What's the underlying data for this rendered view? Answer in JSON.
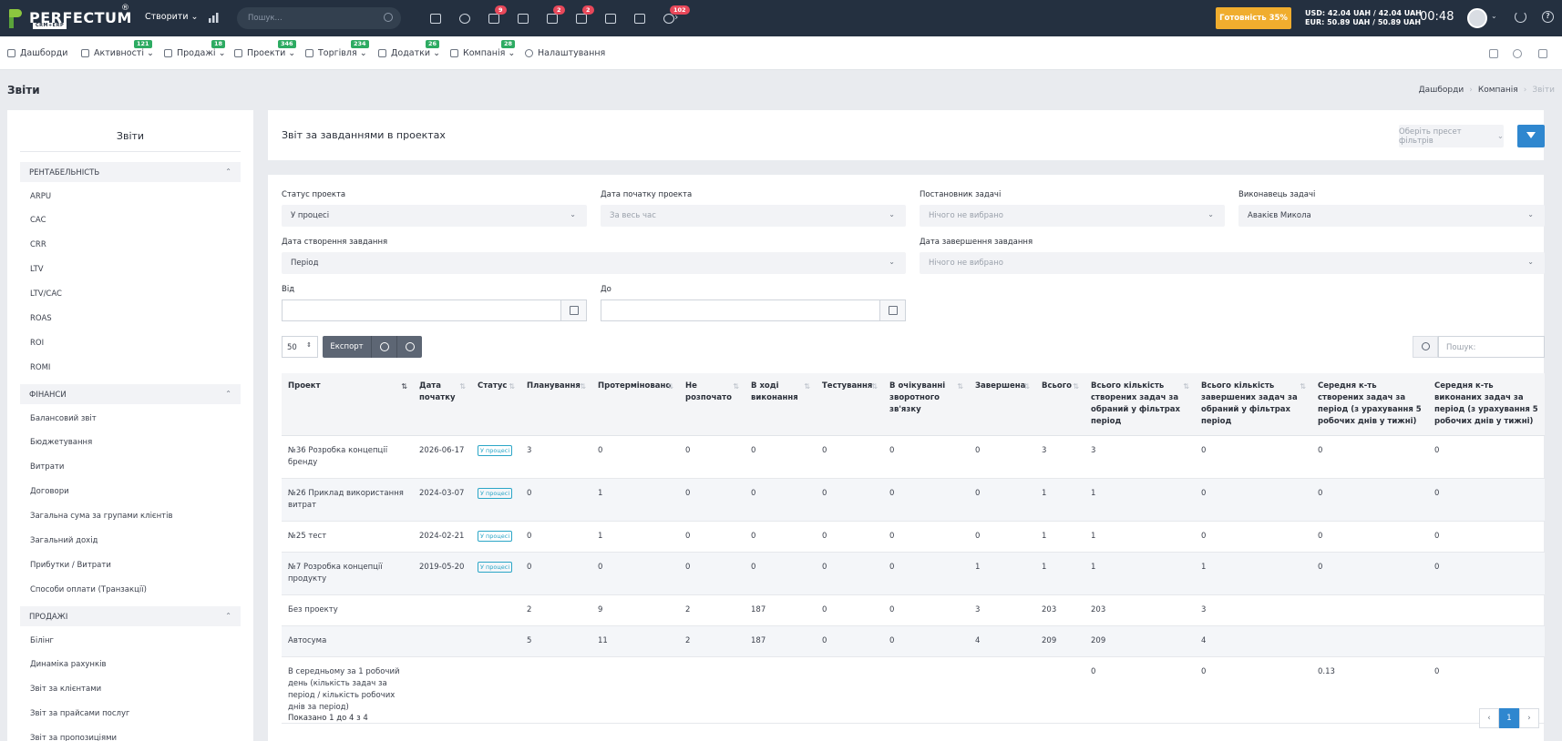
{
  "topbar": {
    "logo": "PERFECTUM",
    "logo_sub": "CRM+ERP",
    "create_label": "Створити",
    "search_placeholder": "Пошук...",
    "icons": [
      {
        "name": "calendar-icon",
        "badge": ""
      },
      {
        "name": "chat-icon",
        "badge": ""
      },
      {
        "name": "tasks-icon",
        "badge": "9"
      },
      {
        "name": "clipboard-icon",
        "badge": ""
      },
      {
        "name": "comments-icon",
        "badge": "2"
      },
      {
        "name": "messages-icon",
        "badge": "2"
      },
      {
        "name": "file-icon",
        "badge": ""
      },
      {
        "name": "mail-icon",
        "badge": ""
      },
      {
        "name": "bell-icon",
        "badge": "102"
      }
    ],
    "readiness_label": "Готовність 35%",
    "usd_rate": "USD: 42.04 UAH / 42.04 UAH",
    "eur_rate": "EUR: 50.89 UAH / 50.89 UAH",
    "clock": "00:48"
  },
  "nav": {
    "items": [
      {
        "label": "Дашборди",
        "badge": ""
      },
      {
        "label": "Активності",
        "badge": "121"
      },
      {
        "label": "Продажі",
        "badge": "18"
      },
      {
        "label": "Проекти",
        "badge": "346"
      },
      {
        "label": "Торгівля",
        "badge": "234"
      },
      {
        "label": "Додатки",
        "badge": "26"
      },
      {
        "label": "Компанія",
        "badge": "28"
      },
      {
        "label": "Налаштування",
        "badge": ""
      }
    ]
  },
  "page": {
    "title": "Звіти",
    "breadcrumb": [
      "Дашборди",
      "Компанія",
      "Звіти"
    ]
  },
  "sidebar": {
    "title": "Звіти",
    "sections": [
      {
        "title": "РЕНТАБЕЛЬНІСТЬ",
        "items": [
          "ARPU",
          "CAC",
          "CRR",
          "LTV",
          "LTV/CAC",
          "ROAS",
          "ROI",
          "ROMI"
        ]
      },
      {
        "title": "ФІНАНСИ",
        "items": [
          "Балансовий звіт",
          "Бюджетування",
          "Витрати",
          "Договори",
          "Загальна сума за групами клієнтів",
          "Загальний дохід",
          "Прибутки / Витрати",
          "Способи оплати (Транзакції)"
        ]
      },
      {
        "title": "ПРОДАЖІ",
        "items": [
          "Білінг",
          "Динаміка рахунків",
          "Звіт за клієнтами",
          "Звіт за прайсами послуг",
          "Звіт за пропозиціями"
        ]
      }
    ]
  },
  "report": {
    "title": "Звіт за завданнями в проектах",
    "preset_placeholder": "Оберіть пресет фільтрів"
  },
  "filters": {
    "project_status": {
      "label": "Статус проекта",
      "value": "У процесі"
    },
    "project_start": {
      "label": "Дата початку проекта",
      "value": "За весь час"
    },
    "task_author": {
      "label": "Постановник задачі",
      "value": "Нічого не вибрано"
    },
    "task_assignee": {
      "label": "Виконавець задачі",
      "value": "Авакієв Микола"
    },
    "task_created": {
      "label": "Дата створення завдання",
      "value": "Період"
    },
    "task_finished": {
      "label": "Дата завершення завдання",
      "value": "Нічого не вибрано"
    },
    "from_label": "Від",
    "to_label": "До"
  },
  "toolbar": {
    "page_length": "50",
    "export_label": "Експорт",
    "search_placeholder": "Пошук:"
  },
  "table": {
    "columns": [
      "Проект",
      "Дата початку",
      "Статус",
      "Планування",
      "Протерміновано",
      "Не розпочато",
      "В ході виконання",
      "Тестування",
      "В очікуванні зворотного зв'язку",
      "Завершена",
      "Всього",
      "Всього кількість створених задач за обраний у фільтрах період",
      "Всього кількість завершених задач за обраний у фільтрах період",
      "Середня к-ть створених задач за період (з урахування 5 робочих днів у тижні)",
      "Середня к-ть виконаних задач за період (з урахування 5 робочих днів у тижні)"
    ],
    "rows": [
      [
        "№36 Розробка концепції бренду",
        "2026-06-17",
        "У процесі",
        "3",
        "0",
        "0",
        "0",
        "0",
        "0",
        "0",
        "3",
        "3",
        "0",
        "0",
        "0"
      ],
      [
        "№26 Приклад використання витрат",
        "2024-03-07",
        "У процесі",
        "0",
        "1",
        "0",
        "0",
        "0",
        "0",
        "0",
        "1",
        "1",
        "0",
        "0",
        "0"
      ],
      [
        "№25 тест",
        "2024-02-21",
        "У процесі",
        "0",
        "1",
        "0",
        "0",
        "0",
        "0",
        "0",
        "1",
        "1",
        "0",
        "0",
        "0"
      ],
      [
        "№7 Розробка концепції продукту",
        "2019-05-20",
        "У процесі",
        "0",
        "0",
        "0",
        "0",
        "0",
        "0",
        "1",
        "1",
        "1",
        "1",
        "0",
        "0"
      ],
      [
        "Без проекту",
        "",
        "",
        "2",
        "9",
        "2",
        "187",
        "0",
        "0",
        "3",
        "203",
        "203",
        "3",
        "",
        ""
      ],
      [
        "Автосума",
        "",
        "",
        "5",
        "11",
        "2",
        "187",
        "0",
        "0",
        "4",
        "209",
        "209",
        "4",
        "",
        ""
      ],
      [
        "В середньому за 1 робочий день (кількість задач за період / кількість робочих днів за період)",
        "",
        "",
        "",
        "",
        "",
        "",
        "",
        "",
        "",
        "",
        "0",
        "0",
        "0.13",
        "0"
      ]
    ]
  },
  "footer": {
    "shown": "Показано 1 до 4 з 4",
    "prev": "‹",
    "page": "1",
    "next": "›"
  }
}
